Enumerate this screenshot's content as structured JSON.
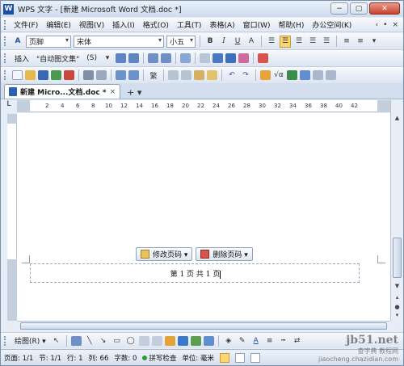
{
  "window": {
    "title": "WPS 文字 - [新建 Microsoft Word 文档.doc *]",
    "logo_letter": "W",
    "minimize": "−",
    "restore": "▢",
    "close": "✕"
  },
  "menubar": {
    "items": [
      "文件(F)",
      "编辑(E)",
      "视图(V)",
      "插入(I)",
      "格式(O)",
      "工具(T)",
      "表格(A)",
      "窗口(W)",
      "帮助(H)",
      "办公空间(K)"
    ],
    "right_icons": [
      "‹",
      "•",
      "×"
    ]
  },
  "format_toolbar": {
    "style": "页脚",
    "font": "宋体",
    "size": "小五",
    "bold": "B",
    "italic": "I",
    "underline": "U",
    "font_color": "A"
  },
  "insert_toolbar": {
    "insert_label": "插入",
    "autotext": "\"自动图文集\"",
    "page_num_symbol": "(S)"
  },
  "standard_toolbar": {
    "traditional": "繁"
  },
  "tabs": {
    "doc_tab_label": "新建 Micro...文档.doc *",
    "close": "×",
    "new_tab": "+ ▾"
  },
  "ruler": {
    "ticks": [
      "2",
      "4",
      "6",
      "8",
      "10",
      "12",
      "14",
      "16",
      "18",
      "20",
      "22",
      "24",
      "26",
      "28",
      "30",
      "32",
      "34",
      "36",
      "38",
      "40",
      "42"
    ]
  },
  "page_buttons": {
    "modify": "修改页码 ▾",
    "delete": "删除页码 ▾"
  },
  "footer": {
    "text": "第 1 页 共 1 页"
  },
  "drawing_toolbar": {
    "label": "绘图(R) ▾"
  },
  "statusbar": {
    "page": "页面: 1/1",
    "section": "节: 1/1",
    "line": "行: 1",
    "column": "列: 66",
    "words": "字数: 0",
    "spell": "拼写检查",
    "unit": "单位: 毫米"
  },
  "watermark": {
    "line1": "jb51.net",
    "line2": "查字典 教程网",
    "line3": "jiaocheng.chazidian.com"
  }
}
